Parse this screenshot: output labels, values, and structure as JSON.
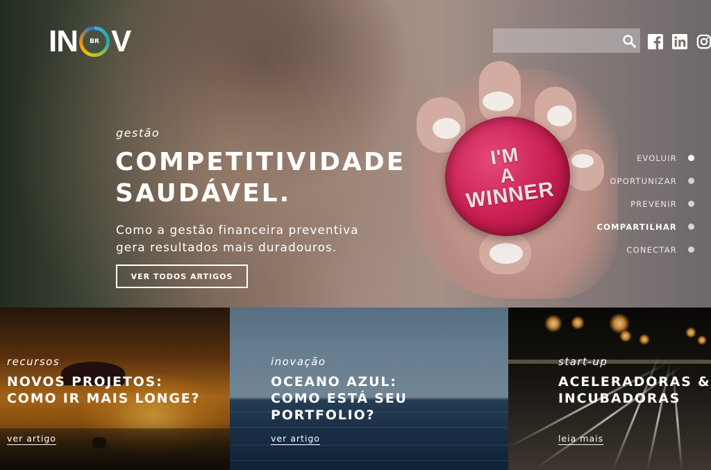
{
  "header": {
    "logo": {
      "left": "IN",
      "ring_text": "BR",
      "right": "V"
    },
    "search": {
      "placeholder": "",
      "value": ""
    },
    "social": [
      "facebook-icon",
      "linkedin-icon",
      "instagram-icon"
    ]
  },
  "hero": {
    "category": "gestão",
    "headline_line1": "COMPETITIVIDADE",
    "headline_line2": "SAUDÁVEL.",
    "subtitle_line1": "Como a gestão financeira preventiva",
    "subtitle_line2": "gera resultados mais duradouros.",
    "cta_label": "VER TODOS ARTIGOS",
    "badge": {
      "line1": "I'M",
      "line2": "A",
      "line3": "WINNER"
    }
  },
  "sidenav": {
    "items": [
      {
        "label": "EVOLUIR",
        "active": false,
        "dot_active": true
      },
      {
        "label": "OPORTUNIZAR",
        "active": false,
        "dot_active": false
      },
      {
        "label": "PREVENIR",
        "active": false,
        "dot_active": false
      },
      {
        "label": "COMPARTILHAR",
        "active": true,
        "dot_active": false
      },
      {
        "label": "CONECTAR",
        "active": false,
        "dot_active": false
      }
    ]
  },
  "cards": [
    {
      "category": "recursos",
      "title_line1": "NOVOS PROJETOS:",
      "title_line2": "COMO IR MAIS LONGE?",
      "title_line3": "",
      "link": "ver artigo"
    },
    {
      "category": "inovação",
      "title_line1": "OCEANO AZUL:",
      "title_line2": "COMO ESTÁ SEU",
      "title_line3": "PORTFOLIO?",
      "link": "ver artigo"
    },
    {
      "category": "start-up",
      "title_line1": "ACELERADORAS &",
      "title_line2": "INCUBADORAS",
      "title_line3": "",
      "link": "leia mais"
    }
  ],
  "colors": {
    "text": "#ffffff",
    "badge": "#c81e50"
  }
}
